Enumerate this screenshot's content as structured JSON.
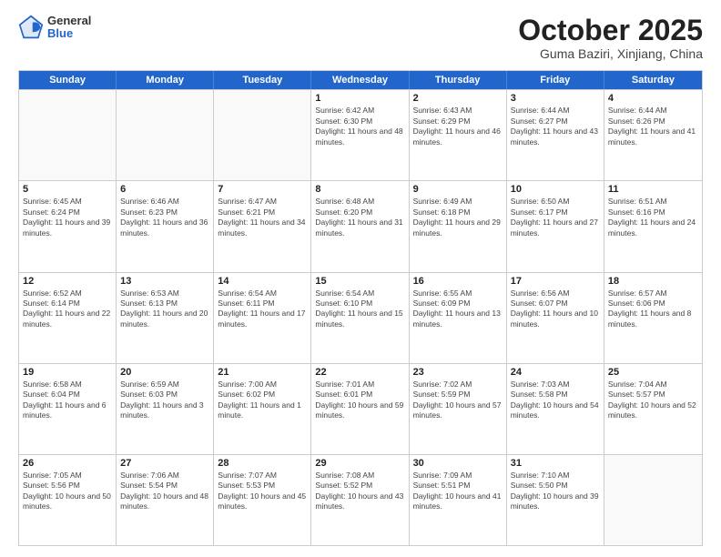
{
  "header": {
    "logo_general": "General",
    "logo_blue": "Blue",
    "month_title": "October 2025",
    "subtitle": "Guma Baziri, Xinjiang, China"
  },
  "days_of_week": [
    "Sunday",
    "Monday",
    "Tuesday",
    "Wednesday",
    "Thursday",
    "Friday",
    "Saturday"
  ],
  "weeks": [
    [
      {
        "day": "",
        "empty": true
      },
      {
        "day": "",
        "empty": true
      },
      {
        "day": "",
        "empty": true
      },
      {
        "day": "1",
        "sunrise": "6:42 AM",
        "sunset": "6:30 PM",
        "daylight": "11 hours and 48 minutes."
      },
      {
        "day": "2",
        "sunrise": "6:43 AM",
        "sunset": "6:29 PM",
        "daylight": "11 hours and 46 minutes."
      },
      {
        "day": "3",
        "sunrise": "6:44 AM",
        "sunset": "6:27 PM",
        "daylight": "11 hours and 43 minutes."
      },
      {
        "day": "4",
        "sunrise": "6:44 AM",
        "sunset": "6:26 PM",
        "daylight": "11 hours and 41 minutes."
      }
    ],
    [
      {
        "day": "5",
        "sunrise": "6:45 AM",
        "sunset": "6:24 PM",
        "daylight": "11 hours and 39 minutes."
      },
      {
        "day": "6",
        "sunrise": "6:46 AM",
        "sunset": "6:23 PM",
        "daylight": "11 hours and 36 minutes."
      },
      {
        "day": "7",
        "sunrise": "6:47 AM",
        "sunset": "6:21 PM",
        "daylight": "11 hours and 34 minutes."
      },
      {
        "day": "8",
        "sunrise": "6:48 AM",
        "sunset": "6:20 PM",
        "daylight": "11 hours and 31 minutes."
      },
      {
        "day": "9",
        "sunrise": "6:49 AM",
        "sunset": "6:18 PM",
        "daylight": "11 hours and 29 minutes."
      },
      {
        "day": "10",
        "sunrise": "6:50 AM",
        "sunset": "6:17 PM",
        "daylight": "11 hours and 27 minutes."
      },
      {
        "day": "11",
        "sunrise": "6:51 AM",
        "sunset": "6:16 PM",
        "daylight": "11 hours and 24 minutes."
      }
    ],
    [
      {
        "day": "12",
        "sunrise": "6:52 AM",
        "sunset": "6:14 PM",
        "daylight": "11 hours and 22 minutes."
      },
      {
        "day": "13",
        "sunrise": "6:53 AM",
        "sunset": "6:13 PM",
        "daylight": "11 hours and 20 minutes."
      },
      {
        "day": "14",
        "sunrise": "6:54 AM",
        "sunset": "6:11 PM",
        "daylight": "11 hours and 17 minutes."
      },
      {
        "day": "15",
        "sunrise": "6:54 AM",
        "sunset": "6:10 PM",
        "daylight": "11 hours and 15 minutes."
      },
      {
        "day": "16",
        "sunrise": "6:55 AM",
        "sunset": "6:09 PM",
        "daylight": "11 hours and 13 minutes."
      },
      {
        "day": "17",
        "sunrise": "6:56 AM",
        "sunset": "6:07 PM",
        "daylight": "11 hours and 10 minutes."
      },
      {
        "day": "18",
        "sunrise": "6:57 AM",
        "sunset": "6:06 PM",
        "daylight": "11 hours and 8 minutes."
      }
    ],
    [
      {
        "day": "19",
        "sunrise": "6:58 AM",
        "sunset": "6:04 PM",
        "daylight": "11 hours and 6 minutes."
      },
      {
        "day": "20",
        "sunrise": "6:59 AM",
        "sunset": "6:03 PM",
        "daylight": "11 hours and 3 minutes."
      },
      {
        "day": "21",
        "sunrise": "7:00 AM",
        "sunset": "6:02 PM",
        "daylight": "11 hours and 1 minute."
      },
      {
        "day": "22",
        "sunrise": "7:01 AM",
        "sunset": "6:01 PM",
        "daylight": "10 hours and 59 minutes."
      },
      {
        "day": "23",
        "sunrise": "7:02 AM",
        "sunset": "5:59 PM",
        "daylight": "10 hours and 57 minutes."
      },
      {
        "day": "24",
        "sunrise": "7:03 AM",
        "sunset": "5:58 PM",
        "daylight": "10 hours and 54 minutes."
      },
      {
        "day": "25",
        "sunrise": "7:04 AM",
        "sunset": "5:57 PM",
        "daylight": "10 hours and 52 minutes."
      }
    ],
    [
      {
        "day": "26",
        "sunrise": "7:05 AM",
        "sunset": "5:56 PM",
        "daylight": "10 hours and 50 minutes."
      },
      {
        "day": "27",
        "sunrise": "7:06 AM",
        "sunset": "5:54 PM",
        "daylight": "10 hours and 48 minutes."
      },
      {
        "day": "28",
        "sunrise": "7:07 AM",
        "sunset": "5:53 PM",
        "daylight": "10 hours and 45 minutes."
      },
      {
        "day": "29",
        "sunrise": "7:08 AM",
        "sunset": "5:52 PM",
        "daylight": "10 hours and 43 minutes."
      },
      {
        "day": "30",
        "sunrise": "7:09 AM",
        "sunset": "5:51 PM",
        "daylight": "10 hours and 41 minutes."
      },
      {
        "day": "31",
        "sunrise": "7:10 AM",
        "sunset": "5:50 PM",
        "daylight": "10 hours and 39 minutes."
      },
      {
        "day": "",
        "empty": true
      }
    ]
  ]
}
